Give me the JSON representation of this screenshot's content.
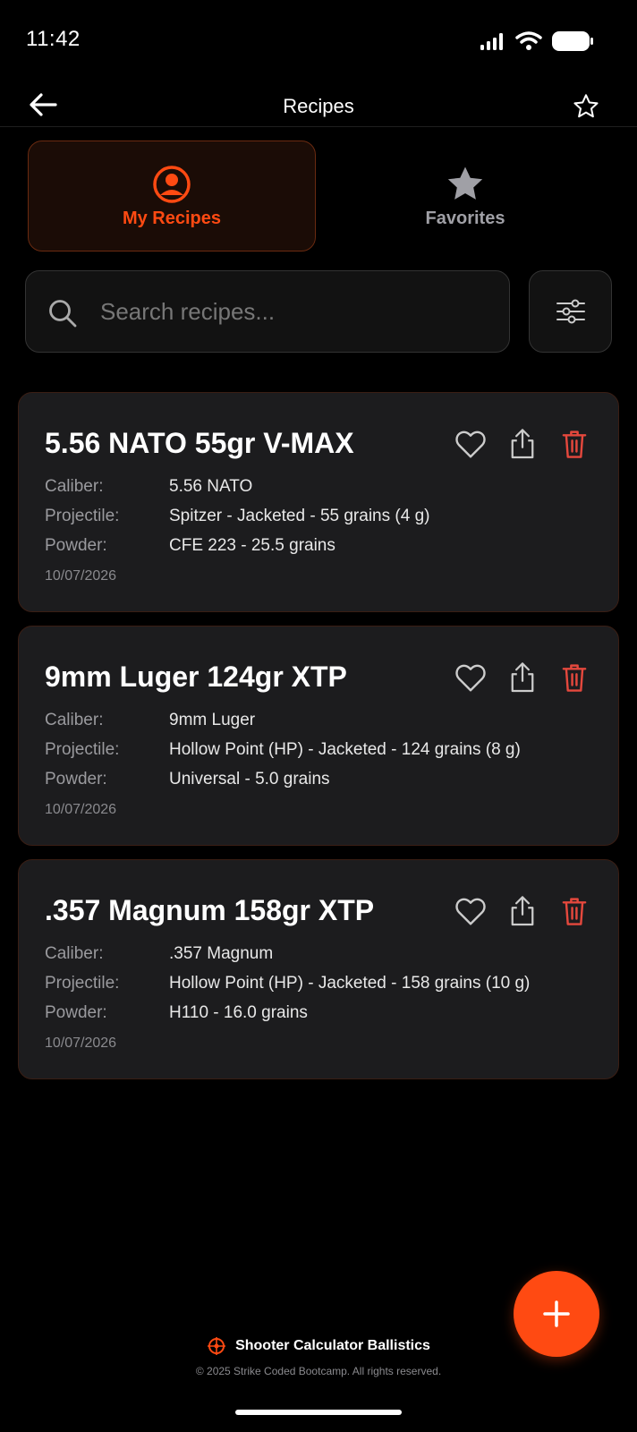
{
  "status_bar": {
    "time": "11:42"
  },
  "header": {
    "title": "Recipes"
  },
  "tabs": [
    {
      "label": "My Recipes",
      "active": true,
      "icon": "user-circle-icon"
    },
    {
      "label": "Favorites",
      "active": false,
      "icon": "star-icon"
    }
  ],
  "search": {
    "placeholder": "Search recipes...",
    "value": ""
  },
  "recipes": [
    {
      "title": "5.56 NATO 55gr V-MAX",
      "caliber_label": "Caliber:",
      "caliber": "5.56 NATO",
      "projectile_label": "Projectile:",
      "projectile": "Spitzer - Jacketed - 55 grains (4 g)",
      "powder_label": "Powder:",
      "powder": "CFE 223 - 25.5 grains",
      "date": "10/07/2026"
    },
    {
      "title": "9mm Luger 124gr XTP",
      "caliber_label": "Caliber:",
      "caliber": "9mm Luger",
      "projectile_label": "Projectile:",
      "projectile": "Hollow Point (HP) - Jacketed - 124 grains (8 g)",
      "powder_label": "Powder:",
      "powder": "Universal - 5.0 grains",
      "date": "10/07/2026"
    },
    {
      "title": ".357 Magnum 158gr XTP",
      "caliber_label": "Caliber:",
      "caliber": ".357 Magnum",
      "projectile_label": "Projectile:",
      "projectile": "Hollow Point (HP) - Jacketed - 158 grains (10 g)",
      "powder_label": "Powder:",
      "powder": "H110 - 16.0 grains",
      "date": "10/07/2026"
    }
  ],
  "footer": {
    "brand": "Shooter Calculator Ballistics",
    "copyright": "© 2025 Strike Coded Bootcamp. All rights reserved."
  },
  "colors": {
    "accent": "#ff4a12",
    "background": "#000000",
    "card": "#1c1c1e",
    "delete": "#e5483d"
  }
}
